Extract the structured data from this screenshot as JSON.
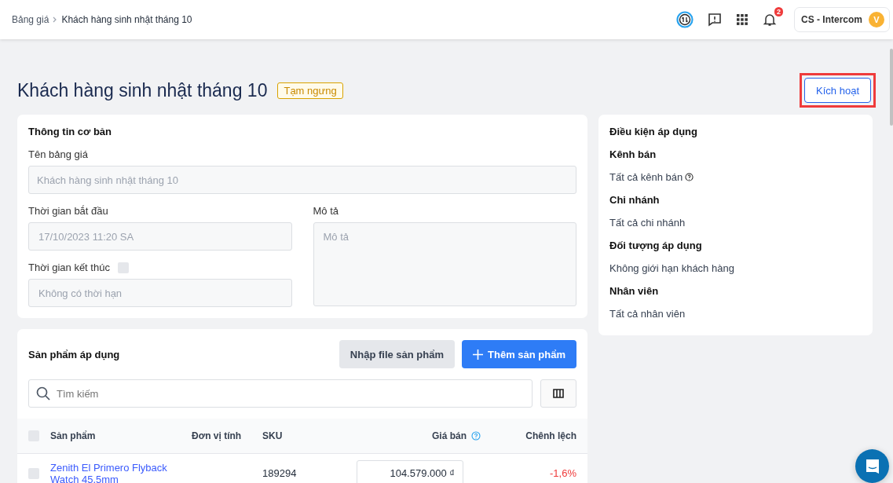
{
  "breadcrumb": [
    {
      "label": "Bảng giá",
      "current": false
    },
    {
      "label": "Khách hàng sinh nhật tháng 10",
      "current": true
    }
  ],
  "header": {
    "notification_count": "2",
    "account": "CS - Intercom",
    "avatar": "V"
  },
  "page": {
    "title": "Khách hàng sinh nhật tháng 10",
    "status": "Tạm ngưng",
    "action": "Kích hoạt",
    "action_highlighted": true
  },
  "basic_info": {
    "title": "Thông tin cơ bản",
    "name": {
      "label": "Tên bảng giá",
      "value": "Khách hàng sinh nhật tháng 10"
    },
    "start": {
      "label": "Thời gian bắt đầu",
      "value": "17/10/2023 11:20 SA"
    },
    "end": {
      "label": "Thời gian kết thúc",
      "checked": false,
      "placeholder": "Không có thời hạn"
    },
    "description": {
      "label": "Mô tả",
      "placeholder": "Mô tả"
    }
  },
  "conditions": {
    "title": "Điều kiện áp dụng",
    "groups": [
      {
        "heading": "Kênh bán",
        "value": "Tất cả kênh bán",
        "help": true
      },
      {
        "heading": "Chi nhánh",
        "value": "Tất cả chi nhánh",
        "help": false
      },
      {
        "heading": "Đối tượng áp dụng",
        "value": "Không giới hạn khách hàng",
        "help": false
      },
      {
        "heading": "Nhân viên",
        "value": "Tất cả nhân viên",
        "help": false
      }
    ]
  },
  "products": {
    "title": "Sản phẩm áp dụng",
    "import_button": "Nhập file sản phẩm",
    "add_button": "Thêm sản phẩm",
    "search": {
      "placeholder": "Tìm kiếm"
    },
    "table": {
      "all_selected": false,
      "columns": [
        "Sản phẩm",
        "Đơn vị tính",
        "SKU",
        "Giá bán",
        "Chênh lệch"
      ],
      "rows": [
        {
          "selected": false,
          "product": "Zenith El Primero Flyback Watch 45.5mm",
          "sku": "189294",
          "price": "104.579.000 ₫",
          "difference": "-1,6%"
        }
      ]
    }
  }
}
